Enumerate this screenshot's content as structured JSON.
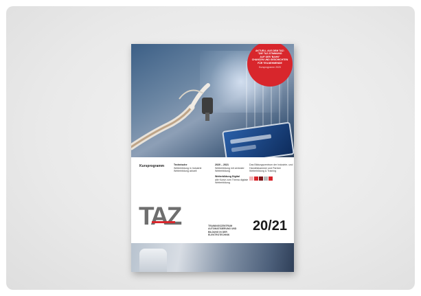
{
  "brochure": {
    "badge": {
      "lines": [
        "AKTUELL AUS DEM TAZ:",
        "\"DIE TAZ-STIMMUNG",
        "AUF DER 'BAHN\"",
        "CHANCEN UND GESCHICHTEN",
        "FÜR TEILNEHMENDE"
      ],
      "footer": "Kursprogramm 2020"
    },
    "info": {
      "title": "Kursprogramm",
      "col1": {
        "head": "Technische",
        "lines": [
          "Weiterbildung in Industrie",
          "Weiterbildung aktuell"
        ]
      },
      "col2": {
        "head": "2020 – 2021",
        "lines": [
          "Weiterbildung mit zentraler",
          "Weiterbildung"
        ]
      },
      "col2b": {
        "head": "Weiterbildung Digital",
        "lines": [
          "alle Kurse zum Thema digitale",
          "Weiterbildung"
        ]
      },
      "col3": {
        "head": "",
        "lines": [
          "Das Bildungszentrum der Industrie- und",
          "Handelskammer und Partner",
          "Weiterbildung & Training"
        ]
      }
    },
    "logo_text": "TAZ",
    "tagline": "TRAININGSZENTRUM AUTOMATISIERUNG UND BILDUNG IN DER ELEKTROTECHNIK",
    "year": "20/21"
  }
}
